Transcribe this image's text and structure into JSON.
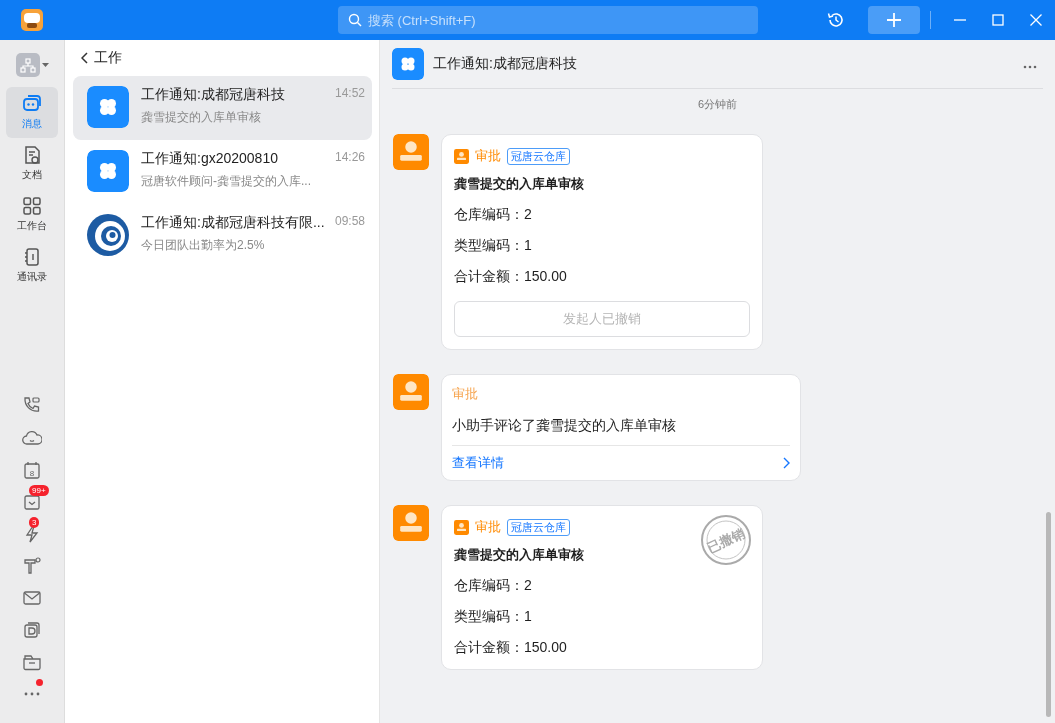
{
  "title_bar": {
    "search": {
      "placeholder": "搜索 (Ctrl+Shift+F)"
    }
  },
  "rail": {
    "items": [
      {
        "kind": "chat",
        "label": "消息",
        "selected": true
      },
      {
        "kind": "doc",
        "label": "文档",
        "selected": false
      },
      {
        "kind": "apps",
        "label": "工作台",
        "selected": false
      },
      {
        "kind": "contacts",
        "label": "通讯录",
        "selected": false
      }
    ],
    "tools": [
      {
        "kind": "phone"
      },
      {
        "kind": "cloud"
      },
      {
        "kind": "calendar",
        "day": "8"
      },
      {
        "kind": "todo",
        "badge": "99+"
      },
      {
        "kind": "bolt",
        "badge": "3"
      },
      {
        "kind": "temp"
      },
      {
        "kind": "mail"
      },
      {
        "kind": "disk"
      },
      {
        "kind": "folder"
      },
      {
        "kind": "more",
        "dot": true
      }
    ]
  },
  "list": {
    "back": "工作",
    "conversations": [
      {
        "kind": "app",
        "title": "工作通知:成都冠唐科技",
        "preview": "龚雪提交的入库单审核",
        "time": "14:52",
        "selected": true
      },
      {
        "kind": "app",
        "title": "工作通知:gx20200810",
        "preview": "冠唐软件顾问-龚雪提交的入库...",
        "time": "14:26",
        "selected": false
      },
      {
        "kind": "logo",
        "title": "工作通知:成都冠唐科技有限...",
        "preview": "今日团队出勤率为2.5%",
        "time": "09:58",
        "selected": false
      }
    ]
  },
  "chat": {
    "title": "工作通知:成都冠唐科技",
    "time": "6分钟前",
    "messages": [
      {
        "kind": "approval",
        "app": "审批",
        "tag": "冠唐云仓库",
        "title": "龚雪提交的入库单审核",
        "fields": [
          "仓库编码：2",
          "类型编码：1",
          "合计金额：150.00"
        ],
        "button": {
          "label": "发起人已撤销",
          "disabled": true
        }
      },
      {
        "kind": "comment",
        "app": "审批",
        "text": "小助手评论了龚雪提交的入库单审核",
        "link": "查看详情"
      },
      {
        "kind": "approval",
        "app": "审批",
        "tag": "冠唐云仓库",
        "title": "龚雪提交的入库单审核",
        "fields": [
          "仓库编码：2",
          "类型编码：1",
          "合计金额：150.00"
        ],
        "stamp": "已撤销"
      }
    ]
  }
}
